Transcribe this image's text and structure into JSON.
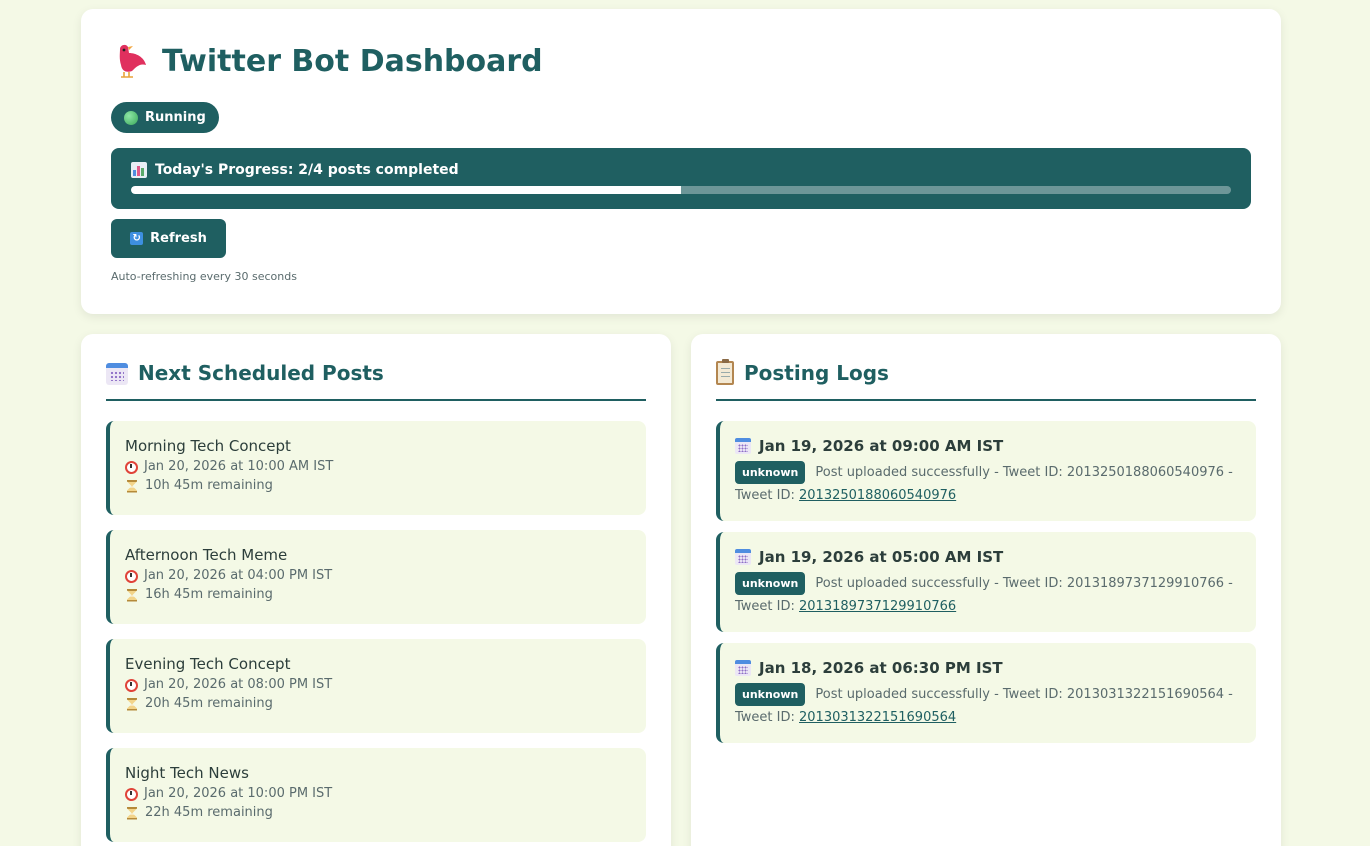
{
  "header": {
    "title": "Twitter Bot Dashboard",
    "status": "Running",
    "progress_label": "Today's Progress: 2/4 posts completed",
    "progress_fraction": 0.5,
    "refresh_label": "Refresh",
    "auto_note": "Auto-refreshing every 30 seconds"
  },
  "scheduled": {
    "heading": "Next Scheduled Posts",
    "items": [
      {
        "title": "Morning Tech Concept",
        "time": "Jan 20, 2026 at 10:00 AM IST",
        "remaining": "10h 45m remaining"
      },
      {
        "title": "Afternoon Tech Meme",
        "time": "Jan 20, 2026 at 04:00 PM IST",
        "remaining": "16h 45m remaining"
      },
      {
        "title": "Evening Tech Concept",
        "time": "Jan 20, 2026 at 08:00 PM IST",
        "remaining": "20h 45m remaining"
      },
      {
        "title": "Night Tech News",
        "time": "Jan 20, 2026 at 10:00 PM IST",
        "remaining": "22h 45m remaining"
      }
    ]
  },
  "logs": {
    "heading": "Posting Logs",
    "items": [
      {
        "date": "Jan 19, 2026 at 09:00 AM IST",
        "badge": "unknown",
        "message": "Post uploaded successfully - Tweet ID: 2013250188060540976 -",
        "tweet_prefix": "Tweet ID: ",
        "tweet_id": "2013250188060540976"
      },
      {
        "date": "Jan 19, 2026 at 05:00 AM IST",
        "badge": "unknown",
        "message": "Post uploaded successfully - Tweet ID: 2013189737129910766 -",
        "tweet_prefix": "Tweet ID: ",
        "tweet_id": "2013189737129910766"
      },
      {
        "date": "Jan 18, 2026 at 06:30 PM IST",
        "badge": "unknown",
        "message": "Post uploaded successfully - Tweet ID: 2013031322151690564 -",
        "tweet_prefix": "Tweet ID: ",
        "tweet_id": "2013031322151690564"
      }
    ]
  },
  "colors": {
    "accent": "#1f5f61",
    "background": "#f4f9e6"
  },
  "icons": {
    "title": "bird-icon",
    "status": "green-dot-icon",
    "progress": "bar-chart-icon",
    "refresh": "refresh-icon",
    "scheduled_heading": "calendar-icon",
    "logs_heading": "clipboard-icon",
    "post_time": "alarm-clock-icon",
    "post_remaining": "hourglass-icon",
    "log_date": "calendar-icon"
  }
}
